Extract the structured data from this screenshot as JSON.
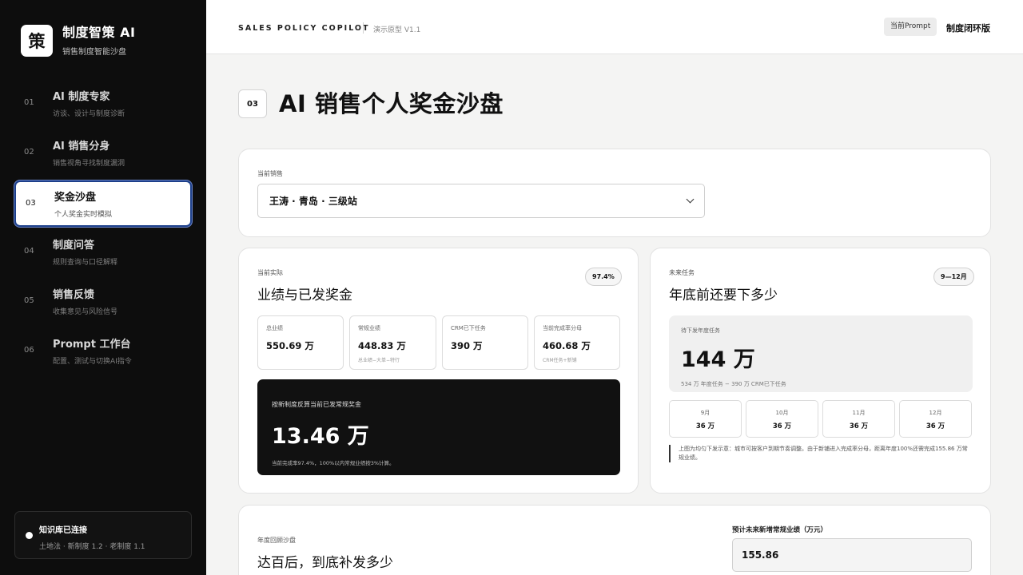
{
  "brand": {
    "logo_char": "策",
    "name": "制度智策 AI",
    "subtitle": "销售制度智能沙盘"
  },
  "nav": [
    {
      "num": "01",
      "title": "AI 制度专家",
      "sub": "访谈、设计与制度诊断"
    },
    {
      "num": "02",
      "title": "AI 销售分身",
      "sub": "销售视角寻找制度漏洞"
    },
    {
      "num": "03",
      "title": "奖金沙盘",
      "sub": "个人奖金实时模拟",
      "active": true
    },
    {
      "num": "04",
      "title": "制度问答",
      "sub": "规则查询与口径解释"
    },
    {
      "num": "05",
      "title": "销售反馈",
      "sub": "收集意见与风险信号"
    },
    {
      "num": "06",
      "title": "Prompt 工作台",
      "sub": "配置、测试与切换AI指令"
    }
  ],
  "kb": {
    "title": "知识库已连接",
    "sub": "土地法 · 新制度 1.2 · 老制度 1.1"
  },
  "topbar": {
    "title": "SALES POLICY COPILOT",
    "version": "演示原型 V1.1",
    "prompt_btn": "当前Prompt",
    "mode": "制度闭环版"
  },
  "page": {
    "num": "03",
    "title": "AI 销售个人奖金沙盘"
  },
  "selector": {
    "label": "当前销售",
    "value": "王涛 · 青岛 · 三级站"
  },
  "current": {
    "eyebrow": "当前实际",
    "title": "业绩与已发奖金",
    "badge": "97.4%",
    "metrics": [
      {
        "label": "总业绩",
        "value": "550.69 万",
        "sub": ""
      },
      {
        "label": "常规业绩",
        "value": "448.83 万",
        "sub": "总业绩−大单−特行"
      },
      {
        "label": "CRM已下任务",
        "value": "390 万",
        "sub": ""
      },
      {
        "label": "当前完成率分母",
        "value": "460.68 万",
        "sub": "CRM任务+新铺"
      }
    ],
    "bonus": {
      "label": "按新制度反算当前已发常规奖金",
      "value": "13.46 万",
      "note": "当前完成率97.4%，100%以内常规业绩按3%计算。"
    }
  },
  "future": {
    "eyebrow": "未来任务",
    "title": "年底前还要下多少",
    "badge": "9—12月",
    "pending": {
      "label": "待下发年度任务",
      "value": "144 万",
      "note": "534 万 年度任务 − 390 万 CRM已下任务"
    },
    "months": [
      {
        "label": "9月",
        "value": "36 万"
      },
      {
        "label": "10月",
        "value": "36 万"
      },
      {
        "label": "11月",
        "value": "36 万"
      },
      {
        "label": "12月",
        "value": "36 万"
      }
    ],
    "note": "上图为均匀下发示意：城市可按客户到期节奏调整。由于新铺进入完成率分母，距离年度100%还需完成155.86 万常规业绩。"
  },
  "review": {
    "eyebrow": "年度回顾沙盘",
    "title": "达百后，到底补发多少",
    "input_label": "预计未来新增常规业绩（万元）",
    "input_value": "155.86"
  }
}
